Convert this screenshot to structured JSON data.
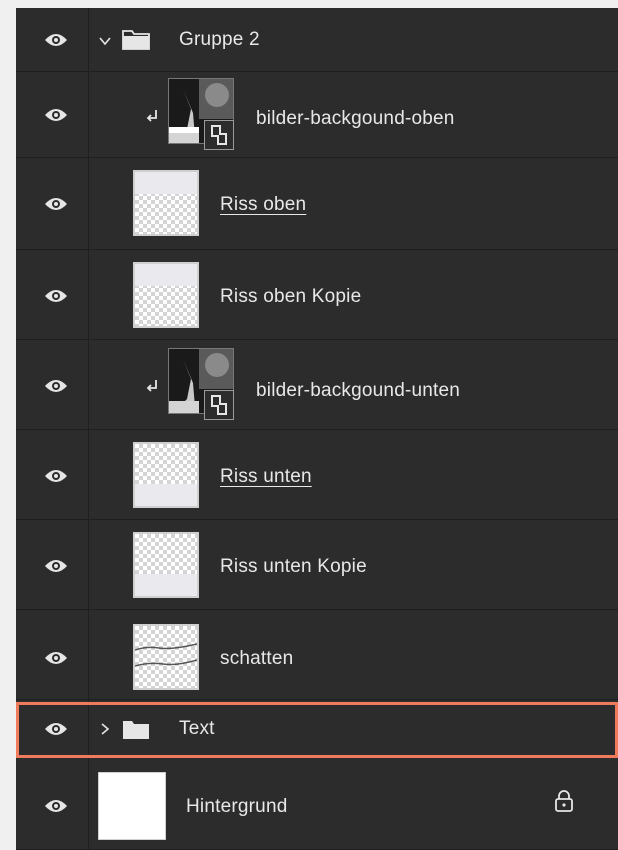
{
  "layers_panel": {
    "layers": [
      {
        "name": "Gruppe 2",
        "kind": "group",
        "expanded": true,
        "visible": true
      },
      {
        "name": "bilder-backgound-oben",
        "kind": "smart-object",
        "clipped": true,
        "visible": true
      },
      {
        "name": "Riss oben",
        "kind": "pixel",
        "linked": true,
        "visible": true
      },
      {
        "name": "Riss oben Kopie",
        "kind": "pixel",
        "visible": true
      },
      {
        "name": "bilder-backgound-unten",
        "kind": "smart-object",
        "clipped": true,
        "visible": true
      },
      {
        "name": "Riss unten",
        "kind": "pixel",
        "linked": true,
        "visible": true
      },
      {
        "name": "Riss unten Kopie",
        "kind": "pixel",
        "visible": true
      },
      {
        "name": "schatten",
        "kind": "pixel",
        "visible": true
      },
      {
        "name": "Text",
        "kind": "group",
        "expanded": false,
        "visible": true,
        "highlighted": true
      },
      {
        "name": "Hintergrund",
        "kind": "background",
        "locked": true,
        "visible": true
      }
    ]
  },
  "colors": {
    "panel_bg": "#2c2c2c",
    "text": "#e8e8e8",
    "highlight": "#ef7a5c"
  },
  "icons": [
    "eye-icon",
    "chevron-down-icon",
    "chevron-right-icon",
    "folder-icon",
    "clip-arrow-icon",
    "smart-object-icon",
    "lock-icon"
  ]
}
